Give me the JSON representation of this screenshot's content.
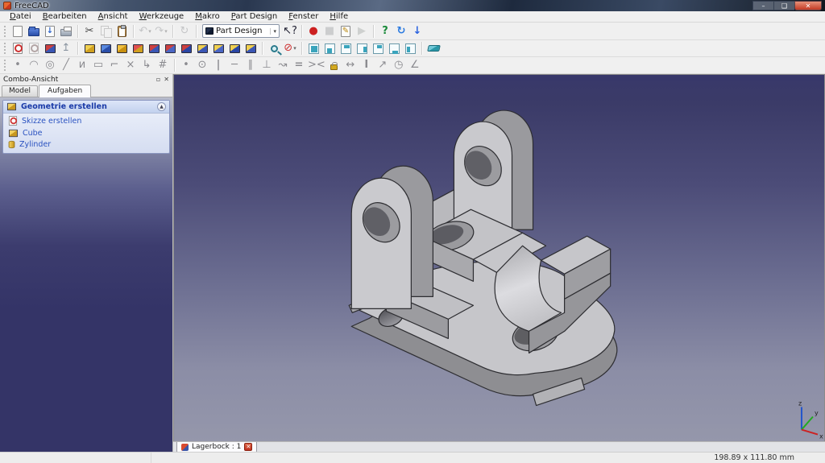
{
  "window": {
    "title": "FreeCAD",
    "controls": {
      "minimize": "–",
      "maximize": "❑",
      "close": "✕"
    }
  },
  "menu": {
    "items": [
      "Datei",
      "Bearbeiten",
      "Ansicht",
      "Werkzeuge",
      "Makro",
      "Part Design",
      "Fenster",
      "Hilfe"
    ]
  },
  "workbench_selector": {
    "value": "Part Design",
    "caret": "▾"
  },
  "toolbars": {
    "standard_a": [
      [
        {
          "n": "new-file",
          "k": "page"
        },
        {
          "n": "open-file",
          "k": "folder"
        },
        {
          "n": "save-file",
          "k": "page",
          "g": "↓",
          "c": "#2a62cc"
        },
        {
          "n": "print",
          "k": "print"
        }
      ],
      [
        {
          "n": "cut",
          "k": "glyph",
          "g": "✂",
          "c": "#444"
        },
        {
          "n": "copy",
          "k": "pages",
          "d": 1
        },
        {
          "n": "paste",
          "k": "clip"
        }
      ],
      [
        {
          "n": "undo",
          "k": "glyph",
          "g": "↶",
          "c": "#8a94a8",
          "d": 1,
          "caret": 1
        },
        {
          "n": "redo",
          "k": "glyph",
          "g": "↷",
          "c": "#8a94a8",
          "d": 1,
          "caret": 1
        }
      ],
      [
        {
          "n": "refresh",
          "k": "glyph",
          "g": "↻",
          "c": "#8a94a8",
          "d": 1
        }
      ]
    ],
    "standard_b": [
      [
        {
          "n": "whats-this",
          "k": "glyph",
          "g": "↖?",
          "c": "#223"
        }
      ],
      [
        {
          "n": "macro-record",
          "k": "glyph",
          "g": "●",
          "c": "#cc2020"
        },
        {
          "n": "macro-stop",
          "k": "glyph",
          "g": "■",
          "c": "#9aa4b0",
          "d": 1
        },
        {
          "n": "macro-edit",
          "k": "page",
          "g": "✎",
          "c": "#b8860b"
        },
        {
          "n": "macro-play",
          "k": "glyph",
          "g": "▶",
          "c": "#9ab0a0",
          "d": 1
        }
      ],
      [
        {
          "n": "addon-help",
          "k": "glyph",
          "g": "?",
          "c": "#1a8a3a",
          "b": 1
        },
        {
          "n": "web-refresh",
          "k": "glyph",
          "g": "↻",
          "c": "#2a7ae0",
          "b": 1
        },
        {
          "n": "download-update",
          "k": "glyph",
          "g": "↓",
          "c": "#2a62e0",
          "b": 1
        }
      ]
    ],
    "partdesign": [
      [
        {
          "n": "create-sketch",
          "k": "sketch"
        },
        {
          "n": "edit-sketch",
          "k": "sketch",
          "d": 1
        },
        {
          "n": "map-sketch-to-face",
          "k": "cube",
          "t": "#cc4040",
          "f": "#3a56b4"
        },
        {
          "n": "leave-sketch",
          "k": "glyph",
          "g": "↥",
          "c": "#8a94a0"
        }
      ],
      [
        {
          "n": "pad",
          "k": "cube",
          "t": "#f0d050",
          "f": "#d0a020"
        },
        {
          "n": "pocket",
          "k": "cube",
          "t": "#5a8ae0",
          "f": "#2a4ea8"
        },
        {
          "n": "revolution",
          "k": "cube",
          "t": "#f0c040",
          "f": "#c89010"
        },
        {
          "n": "groove",
          "k": "cube",
          "t": "#e05050",
          "f": "#d0a020"
        },
        {
          "n": "fillet",
          "k": "cube",
          "t": "#cc4040",
          "f": "#3a56b4"
        },
        {
          "n": "chamfer",
          "k": "cube",
          "t": "#cc4040",
          "f": "#4a66c4"
        },
        {
          "n": "draft",
          "k": "cube",
          "t": "#cc4040",
          "f": "#2a46a4"
        },
        {
          "n": "mirrored-feature",
          "k": "cube",
          "t": "#f0d050",
          "f": "#3a56b4"
        },
        {
          "n": "linear-pattern",
          "k": "cube",
          "t": "#f0d050",
          "f": "#4a66c4"
        },
        {
          "n": "polar-pattern",
          "k": "cube",
          "t": "#f0d050",
          "f": "#2a46a4"
        },
        {
          "n": "multi-transform",
          "k": "cube",
          "t": "#f0d050",
          "f": "#3a56b4"
        }
      ],
      [
        {
          "n": "fit-all",
          "k": "mag"
        },
        {
          "n": "clipping-plane",
          "k": "glyph",
          "g": "⊘",
          "c": "#cc3030",
          "caret": 1
        }
      ],
      [
        {
          "n": "view-axonometric",
          "k": "vc",
          "face": "axo"
        },
        {
          "n": "view-front",
          "k": "vc",
          "face": "front"
        },
        {
          "n": "view-top",
          "k": "vc",
          "face": "top"
        },
        {
          "n": "view-right",
          "k": "vc",
          "face": "right"
        },
        {
          "n": "view-rear",
          "k": "vc",
          "face": "rear"
        },
        {
          "n": "view-bottom",
          "k": "vc",
          "face": "bottom"
        },
        {
          "n": "view-left",
          "k": "vc",
          "face": "left"
        }
      ],
      [
        {
          "n": "draw-style",
          "k": "slab",
          "t": "#70c8d8",
          "f": "#2a98a8"
        }
      ]
    ],
    "sketcher": [
      [
        {
          "n": "sketch-point",
          "k": "glyph",
          "g": "•",
          "c": "#8b8b90"
        },
        {
          "n": "sketch-arc",
          "k": "glyph",
          "g": "◠",
          "c": "#8b8b90"
        },
        {
          "n": "sketch-circle",
          "k": "glyph",
          "g": "◎",
          "c": "#8b8b90"
        },
        {
          "n": "sketch-line",
          "k": "glyph",
          "g": "╱",
          "c": "#8b8b90"
        },
        {
          "n": "sketch-polyline",
          "k": "glyph",
          "g": "и",
          "c": "#8b8b90"
        },
        {
          "n": "sketch-rectangle",
          "k": "glyph",
          "g": "▭",
          "c": "#8b8b90"
        },
        {
          "n": "sketch-fillet",
          "k": "glyph",
          "g": "⌐",
          "c": "#8b8b90"
        },
        {
          "n": "sketch-trim",
          "k": "glyph",
          "g": "×",
          "c": "#8b8b90"
        },
        {
          "n": "sketch-external-geometry",
          "k": "glyph",
          "g": "↳",
          "c": "#8b8b90"
        },
        {
          "n": "sketch-construction-mode",
          "k": "glyph",
          "g": "#",
          "c": "#8b8b90"
        }
      ],
      [
        {
          "n": "constraint-coincident",
          "k": "glyph",
          "g": "•",
          "c": "#8b8b90"
        },
        {
          "n": "constraint-point-on-object",
          "k": "glyph",
          "g": "⊙",
          "c": "#8b8b90"
        },
        {
          "n": "constraint-vertical",
          "k": "glyph",
          "g": "|",
          "c": "#8b8b90",
          "b": 1
        },
        {
          "n": "constraint-horizontal",
          "k": "glyph",
          "g": "─",
          "c": "#8b8b90",
          "b": 1
        },
        {
          "n": "constraint-parallel",
          "k": "glyph",
          "g": "∥",
          "c": "#8b8b90"
        },
        {
          "n": "constraint-perpendicular",
          "k": "glyph",
          "g": "⊥",
          "c": "#8b8b90"
        },
        {
          "n": "constraint-tangent",
          "k": "glyph",
          "g": "↝",
          "c": "#8b8b90"
        },
        {
          "n": "constraint-equal",
          "k": "glyph",
          "g": "=",
          "c": "#8b8b90",
          "b": 1
        },
        {
          "n": "constraint-symmetric",
          "k": "glyph",
          "g": "><",
          "c": "#8b8b90"
        },
        {
          "n": "constraint-lock",
          "k": "lock"
        },
        {
          "n": "constraint-distance-x",
          "k": "glyph",
          "g": "↔",
          "c": "#8b8b90"
        },
        {
          "n": "constraint-distance-y",
          "k": "glyph",
          "g": "I",
          "c": "#8b8b90",
          "b": 1
        },
        {
          "n": "constraint-length",
          "k": "glyph",
          "g": "↗",
          "c": "#8b8b90"
        },
        {
          "n": "constraint-radius",
          "k": "glyph",
          "g": "◷",
          "c": "#8b8b90"
        },
        {
          "n": "constraint-angle",
          "k": "glyph",
          "g": "∠",
          "c": "#8b8b90"
        }
      ]
    ]
  },
  "panel": {
    "title": "Combo-Ansicht",
    "float_icon": "▫",
    "close_icon": "✕",
    "tabs": [
      {
        "label": "Model"
      },
      {
        "label": "Aufgaben"
      }
    ],
    "task_header": {
      "label": "Geometrie erstellen",
      "collapse_glyph": "▲"
    },
    "task_items": [
      {
        "n": "task-create-sketch",
        "label": "Skizze erstellen",
        "k": "sketch"
      },
      {
        "n": "task-cube",
        "label": "Cube",
        "k": "cube",
        "t": "#f0d060",
        "f": "#c89820"
      },
      {
        "n": "task-cylinder",
        "label": "Zylinder",
        "k": "cyl"
      }
    ]
  },
  "document_tab": {
    "label": "Lagerbock : 1",
    "close_glyph": "✕"
  },
  "viewport": {
    "axis_x": "x",
    "axis_y": "y",
    "axis_z": "z"
  },
  "statusbar": {
    "dimensions": "198.89 x 111.80 mm"
  },
  "colors": {
    "accent_blue": "#2a52c0",
    "viewport_top": "#38386a",
    "viewport_bottom": "#9597ab",
    "part_gray": "#c6c6ca"
  }
}
